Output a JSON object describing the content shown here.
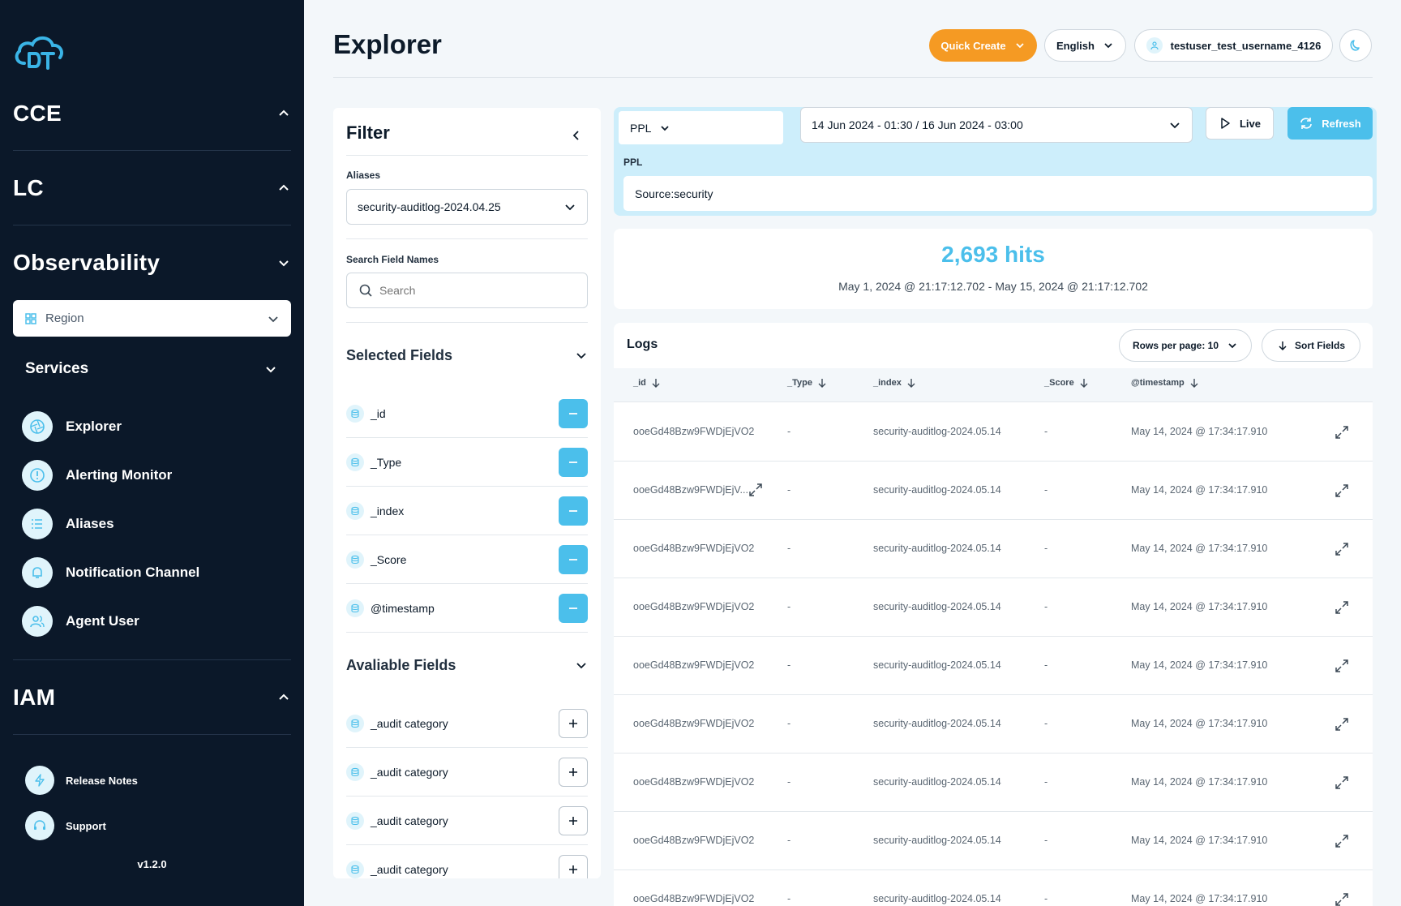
{
  "sidebar": {
    "sections": [
      {
        "label": "CCE",
        "expanded": false
      },
      {
        "label": "LC",
        "expanded": false
      },
      {
        "label": "Observability",
        "expanded": true
      },
      {
        "label": "IAM",
        "expanded": false
      }
    ],
    "region_placeholder": "Region",
    "services_label": "Services",
    "services": [
      {
        "label": "Explorer",
        "icon": "aperture-icon"
      },
      {
        "label": "Alerting Monitor",
        "icon": "alert-circle-icon"
      },
      {
        "label": "Aliases",
        "icon": "list-icon"
      },
      {
        "label": "Notification Channel",
        "icon": "bell-icon"
      },
      {
        "label": "Agent User",
        "icon": "users-icon"
      }
    ],
    "footer": [
      {
        "label": "Release Notes",
        "icon": "lightning-icon"
      },
      {
        "label": "Support",
        "icon": "headset-icon"
      }
    ],
    "version": "v1.2.0"
  },
  "header": {
    "title": "Explorer",
    "quick_create": "Quick Create",
    "language": "English",
    "username": "testuser_test_username_4126"
  },
  "filter": {
    "title": "Filter",
    "aliases_label": "Aliases",
    "aliases_value": "security-auditlog-2024.04.25",
    "search_label": "Search Field Names",
    "search_placeholder": "Search",
    "selected_title": "Selected Fields",
    "selected_fields": [
      "_id",
      "_Type",
      "_index",
      "_Score",
      "@timestamp"
    ],
    "available_title": "Avaliable Fields",
    "available_fields": [
      "_audit category",
      "_audit category",
      "_audit category",
      "_audit category"
    ]
  },
  "query": {
    "language": "PPL",
    "date_range": "14 Jun 2024 - 01:30 / 16 Jun 2024 - 03:00",
    "live_label": "Live",
    "refresh_label": "Refresh",
    "ppl_label": "PPL",
    "ppl_value": "Source:security"
  },
  "hits": {
    "count": "2,693 hits",
    "range": "May 1, 2024 @ 21:17:12.702 - May 15, 2024 @ 21:17:12.702"
  },
  "logs": {
    "title": "Logs",
    "rows_per_page": "Rows per page: 10",
    "sort_fields": "Sort Fields",
    "columns": [
      "_id",
      "_Type",
      "_index",
      "_Score",
      "@timestamp"
    ],
    "rows": [
      {
        "id": "ooeGd48Bzw9FWDjEjVO2",
        "type": "-",
        "index": "security-auditlog-2024.05.14",
        "score": "-",
        "timestamp": "May 14, 2024 @ 17:34:17.910"
      },
      {
        "id": "ooeGd48Bzw9FWDjEjV...",
        "type": "-",
        "index": "security-auditlog-2024.05.14",
        "score": "-",
        "timestamp": "May 14, 2024 @ 17:34:17.910"
      },
      {
        "id": "ooeGd48Bzw9FWDjEjVO2",
        "type": "-",
        "index": "security-auditlog-2024.05.14",
        "score": "-",
        "timestamp": "May 14, 2024 @ 17:34:17.910"
      },
      {
        "id": "ooeGd48Bzw9FWDjEjVO2",
        "type": "-",
        "index": "security-auditlog-2024.05.14",
        "score": "-",
        "timestamp": "May 14, 2024 @ 17:34:17.910"
      },
      {
        "id": "ooeGd48Bzw9FWDjEjVO2",
        "type": "-",
        "index": "security-auditlog-2024.05.14",
        "score": "-",
        "timestamp": "May 14, 2024 @ 17:34:17.910"
      },
      {
        "id": "ooeGd48Bzw9FWDjEjVO2",
        "type": "-",
        "index": "security-auditlog-2024.05.14",
        "score": "-",
        "timestamp": "May 14, 2024 @ 17:34:17.910"
      },
      {
        "id": "ooeGd48Bzw9FWDjEjVO2",
        "type": "-",
        "index": "security-auditlog-2024.05.14",
        "score": "-",
        "timestamp": "May 14, 2024 @ 17:34:17.910"
      },
      {
        "id": "ooeGd48Bzw9FWDjEjVO2",
        "type": "-",
        "index": "security-auditlog-2024.05.14",
        "score": "-",
        "timestamp": "May 14, 2024 @ 17:34:17.910"
      },
      {
        "id": "ooeGd48Bzw9FWDjEjVO2",
        "type": "-",
        "index": "security-auditlog-2024.05.14",
        "score": "-",
        "timestamp": "May 14, 2024 @ 17:34:17.910"
      }
    ]
  },
  "colors": {
    "accent": "#4bbfeb",
    "quick_create": "#f59a23",
    "sidebar_bg": "#0b1829"
  }
}
